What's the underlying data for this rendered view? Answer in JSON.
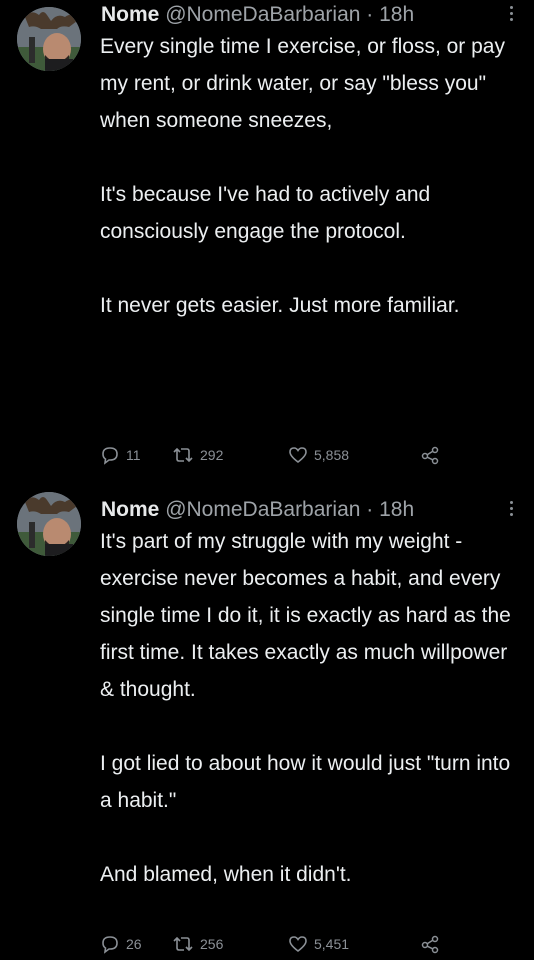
{
  "tweets": [
    {
      "author_name": "Nome",
      "handle": "@NomeDaBarbarian",
      "separator": "·",
      "time": "18h",
      "paragraphs": [
        "Every single time I exercise, or floss, or pay my rent, or drink water, or say \"bless you\" when someone sneezes,",
        "It's because I've had to actively and consciously engage the protocol.",
        "It never gets easier. Just more familiar."
      ],
      "replies": "11",
      "retweets": "292",
      "likes": "5,858"
    },
    {
      "author_name": "Nome",
      "handle": "@NomeDaBarbarian",
      "separator": "·",
      "time": "18h",
      "paragraphs": [
        "It's part of my struggle with my weight - exercise never becomes a habit, and every single time I do it, it is exactly as hard as the first time. It takes exactly as much willpower & thought.",
        "I got lied to about how it would just \"turn into a habit.\"",
        "And blamed, when it didn't."
      ],
      "replies": "26",
      "retweets": "256",
      "likes": "5,451"
    }
  ],
  "colors": {
    "background": "#000000",
    "text": "#e7e9ea",
    "secondary": "#9ea3a8",
    "icon": "#8b9096"
  }
}
